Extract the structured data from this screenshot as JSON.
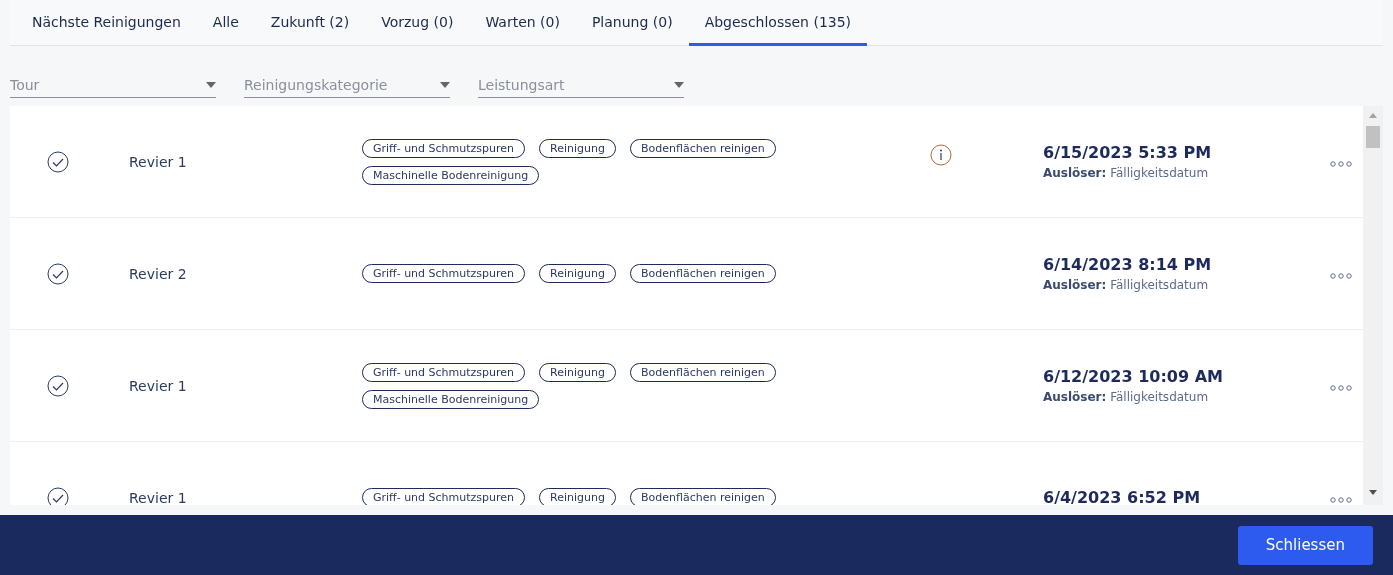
{
  "tabs": [
    {
      "label": "Nächste Reinigungen",
      "selected": false
    },
    {
      "label": "Alle",
      "selected": false
    },
    {
      "label": "Zukunft (2)",
      "selected": false
    },
    {
      "label": "Vorzug (0)",
      "selected": false
    },
    {
      "label": "Warten (0)",
      "selected": false
    },
    {
      "label": "Planung (0)",
      "selected": false
    },
    {
      "label": "Abgeschlossen (135)",
      "selected": true
    }
  ],
  "filters": [
    {
      "placeholder": "Tour"
    },
    {
      "placeholder": "Reinigungskategorie"
    },
    {
      "placeholder": "Leistungsart"
    }
  ],
  "rows": [
    {
      "done": true,
      "name": "Revier 1",
      "tags": [
        "Griff- und Schmutzspuren",
        "Reinigung",
        "Bodenflächen reinigen",
        "Maschinelle Bodenreinigung"
      ],
      "info": true,
      "date": "6/15/2023 5:33 PM",
      "trigger_label": "Auslöser:",
      "trigger": "Fälligkeitsdatum"
    },
    {
      "done": true,
      "name": "Revier 2",
      "tags": [
        "Griff- und Schmutzspuren",
        "Reinigung",
        "Bodenflächen reinigen"
      ],
      "info": false,
      "date": "6/14/2023 8:14 PM",
      "trigger_label": "Auslöser:",
      "trigger": "Fälligkeitsdatum"
    },
    {
      "done": true,
      "name": "Revier 1",
      "tags": [
        "Griff- und Schmutzspuren",
        "Reinigung",
        "Bodenflächen reinigen",
        "Maschinelle Bodenreinigung"
      ],
      "info": false,
      "date": "6/12/2023 10:09 AM",
      "trigger_label": "Auslöser:",
      "trigger": "Fälligkeitsdatum"
    },
    {
      "done": true,
      "name": "Revier 1",
      "tags": [
        "Griff- und Schmutzspuren",
        "Reinigung",
        "Bodenflächen reinigen"
      ],
      "info": false,
      "date": "6/4/2023 6:52 PM"
    }
  ],
  "footer": {
    "button": "Schliessen"
  }
}
